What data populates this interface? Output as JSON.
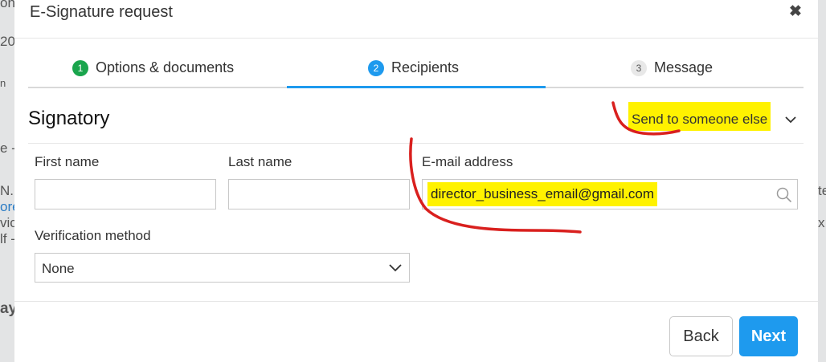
{
  "modal": {
    "title": "E-Signature request",
    "close_glyph": "✖"
  },
  "steps": [
    {
      "number": "1",
      "label": "Options & documents",
      "state": "done"
    },
    {
      "number": "2",
      "label": "Recipients",
      "state": "active"
    },
    {
      "number": "3",
      "label": "Message",
      "state": "pending"
    }
  ],
  "signatory": {
    "title": "Signatory",
    "send_to_label": "Send to someone else"
  },
  "form": {
    "first_name_label": "First name",
    "first_name_value": "",
    "last_name_label": "Last name",
    "last_name_value": "",
    "email_label": "E-mail address",
    "email_value": "director_business_email@gmail.com",
    "verification_label": "Verification method",
    "verification_value": "None"
  },
  "footer": {
    "back_label": "Back",
    "next_label": "Next"
  },
  "background": {
    "fragments": [
      "on",
      "20",
      "n",
      "e -",
      "N.F",
      "ore",
      "vic",
      "lf -",
      "ayr",
      "te",
      "x"
    ]
  },
  "colors": {
    "accent": "#1e9aee",
    "success": "#1aa54d",
    "highlight": "#fff200",
    "annotation_red": "#d9201e"
  },
  "icons": {
    "close": "close-icon",
    "chevron": "chevron-down-icon",
    "search": "search-icon"
  }
}
